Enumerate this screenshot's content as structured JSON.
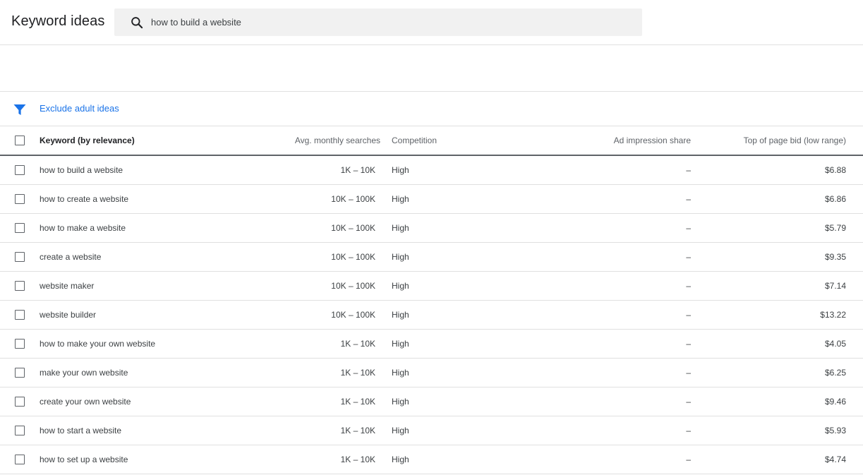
{
  "header": {
    "title": "Keyword ideas",
    "search_value": "how to build a website",
    "search_icon": "search-icon"
  },
  "filter": {
    "icon": "filter-icon",
    "chip_label": "Exclude adult ideas",
    "accent_color": "#1a73e8"
  },
  "table": {
    "columns": [
      "Keyword (by relevance)",
      "Avg. monthly searches",
      "Competition",
      "Ad impression share",
      "Top of page bid (low range)"
    ],
    "rows": [
      {
        "keyword": "how to build a website",
        "searches": "1K – 10K",
        "competition": "High",
        "impression_share": "–",
        "bid_low": "$6.88"
      },
      {
        "keyword": "how to create a website",
        "searches": "10K – 100K",
        "competition": "High",
        "impression_share": "–",
        "bid_low": "$6.86"
      },
      {
        "keyword": "how to make a website",
        "searches": "10K – 100K",
        "competition": "High",
        "impression_share": "–",
        "bid_low": "$5.79"
      },
      {
        "keyword": "create a website",
        "searches": "10K – 100K",
        "competition": "High",
        "impression_share": "–",
        "bid_low": "$9.35"
      },
      {
        "keyword": "website maker",
        "searches": "10K – 100K",
        "competition": "High",
        "impression_share": "–",
        "bid_low": "$7.14"
      },
      {
        "keyword": "website builder",
        "searches": "10K – 100K",
        "competition": "High",
        "impression_share": "–",
        "bid_low": "$13.22"
      },
      {
        "keyword": "how to make your own website",
        "searches": "1K – 10K",
        "competition": "High",
        "impression_share": "–",
        "bid_low": "$4.05"
      },
      {
        "keyword": "make your own website",
        "searches": "1K – 10K",
        "competition": "High",
        "impression_share": "–",
        "bid_low": "$6.25"
      },
      {
        "keyword": "create your own website",
        "searches": "1K – 10K",
        "competition": "High",
        "impression_share": "–",
        "bid_low": "$9.46"
      },
      {
        "keyword": "how to start a website",
        "searches": "1K – 10K",
        "competition": "High",
        "impression_share": "–",
        "bid_low": "$5.93"
      },
      {
        "keyword": "how to set up a website",
        "searches": "1K – 10K",
        "competition": "High",
        "impression_share": "–",
        "bid_low": "$4.74"
      }
    ]
  }
}
